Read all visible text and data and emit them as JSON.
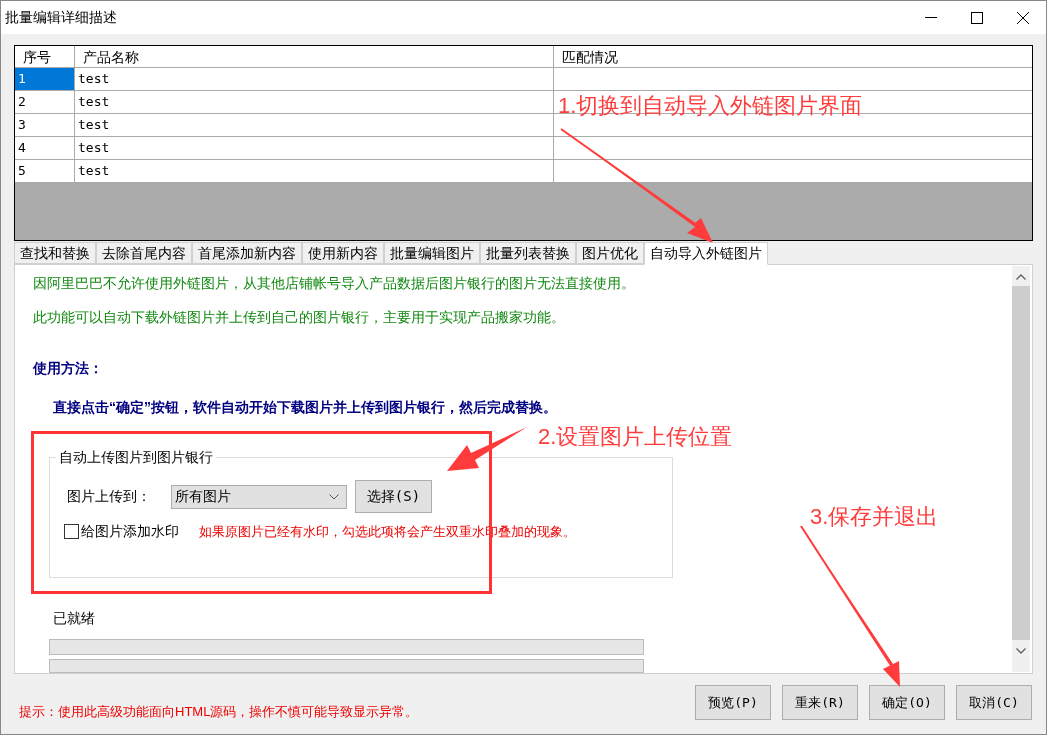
{
  "window": {
    "title": "批量编辑详细描述"
  },
  "table": {
    "columns": [
      "序号",
      "产品名称",
      "匹配情况"
    ],
    "rows": [
      {
        "cells": [
          "1",
          "test"
        ],
        "selected": true
      },
      {
        "cells": [
          "2",
          "test"
        ],
        "selected": false
      },
      {
        "cells": [
          "3",
          "test"
        ],
        "selected": false
      },
      {
        "cells": [
          "4",
          "test"
        ],
        "selected": false
      },
      {
        "cells": [
          "5",
          "test"
        ],
        "selected": false
      }
    ]
  },
  "tabs": [
    {
      "label": "查找和替换",
      "selected": false
    },
    {
      "label": "去除首尾内容",
      "selected": false
    },
    {
      "label": "首尾添加新内容",
      "selected": false
    },
    {
      "label": "使用新内容",
      "selected": false
    },
    {
      "label": "批量编辑图片",
      "selected": false
    },
    {
      "label": "批量列表替换",
      "selected": false
    },
    {
      "label": "图片优化",
      "selected": false
    },
    {
      "label": "自动导入外链图片",
      "selected": true
    }
  ],
  "panel": {
    "intro": [
      "因阿里巴巴不允许使用外链图片，从其他店铺帐号导入产品数据后图片银行的图片无法直接使用。",
      "此功能可以自动下载外链图片并上传到自己的图片银行，主要用于实现产品搬家功能。"
    ],
    "usage_heading": "使用方法：",
    "usage_text": "直接点击“确定”按钮，软件自动开始下载图片并上传到图片银行，然后完成替换。",
    "group": {
      "title": "自动上传图片到图片银行",
      "upload_label": "图片上传到：",
      "upload_value": "所有图片",
      "choose_button": "选择(S)",
      "watermark": {
        "label": "给图片添加水印",
        "checked": false
      },
      "warning": "如果原图片已经有水印，勾选此项将会产生双重水印叠加的现象。"
    },
    "status": "已就绪",
    "progress": [
      {
        "level": 0
      },
      {
        "level": 0
      }
    ]
  },
  "hint": "提示：使用此高级功能面向HTML源码，操作不慎可能导致显示异常。",
  "buttons": [
    "预览(P)",
    "重来(R)",
    "确定(O)",
    "取消(C)"
  ],
  "annotations": [
    "1.切换到自动导入外链图片界面",
    "2.设置图片上传位置",
    "3.保存并退出"
  ]
}
